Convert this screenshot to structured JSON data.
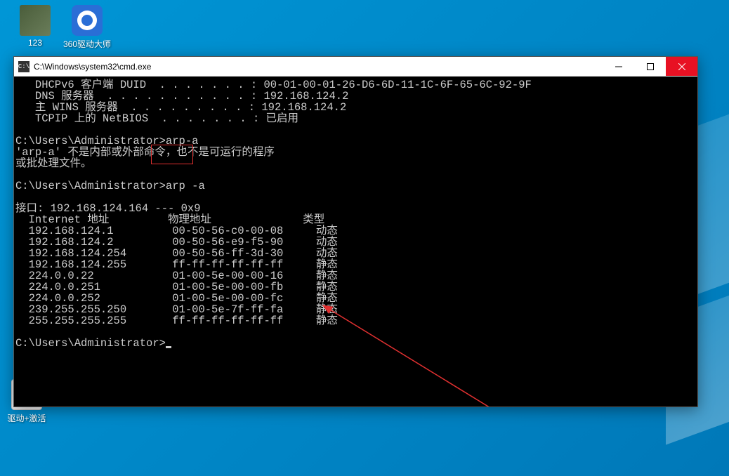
{
  "desktop": {
    "icons": [
      {
        "label": "123"
      },
      {
        "label": "360驱动大师"
      },
      {
        "label": "驱动+激活"
      }
    ]
  },
  "window": {
    "title": "C:\\Windows\\system32\\cmd.exe"
  },
  "terminal": {
    "lines": [
      "   DHCPv6 客户端 DUID  . . . . . . . : 00-01-00-01-26-D6-6D-11-1C-6F-65-6C-92-9F",
      "   DNS 服务器  . . . . . . . . . . . : 192.168.124.2",
      "   主 WINS 服务器  . . . . . . . . . : 192.168.124.2",
      "   TCPIP 上的 NetBIOS  . . . . . . . : 已启用",
      "",
      "C:\\Users\\Administrator>arp-a",
      "'arp-a' 不是内部或外部命令，也不是可运行的程序",
      "或批处理文件。",
      "",
      "C:\\Users\\Administrator>arp -a",
      "",
      "接口: 192.168.124.164 --- 0x9",
      "  Internet 地址         物理地址              类型",
      "  192.168.124.1         00-50-56-c0-00-08     动态",
      "  192.168.124.2         00-50-56-e9-f5-90     动态",
      "  192.168.124.254       00-50-56-ff-3d-30     动态",
      "  192.168.124.255       ff-ff-ff-ff-ff-ff     静态",
      "  224.0.0.22            01-00-5e-00-00-16     静态",
      "  224.0.0.251           01-00-5e-00-00-fb     静态",
      "  224.0.0.252           01-00-5e-00-00-fc     静态",
      "  239.255.255.250       01-00-5e-7f-ff-fa     静态",
      "  255.255.255.255       ff-ff-ff-ff-ff-ff     静态",
      "",
      "C:\\Users\\Administrator>"
    ],
    "arp_table": {
      "interface": "192.168.124.164 --- 0x9",
      "headers": [
        "Internet 地址",
        "物理地址",
        "类型"
      ],
      "rows": [
        {
          "ip": "192.168.124.1",
          "mac": "00-50-56-c0-00-08",
          "type": "动态"
        },
        {
          "ip": "192.168.124.2",
          "mac": "00-50-56-e9-f5-90",
          "type": "动态"
        },
        {
          "ip": "192.168.124.254",
          "mac": "00-50-56-ff-3d-30",
          "type": "动态"
        },
        {
          "ip": "192.168.124.255",
          "mac": "ff-ff-ff-ff-ff-ff",
          "type": "静态"
        },
        {
          "ip": "224.0.0.22",
          "mac": "01-00-5e-00-00-16",
          "type": "静态"
        },
        {
          "ip": "224.0.0.251",
          "mac": "01-00-5e-00-00-fb",
          "type": "静态"
        },
        {
          "ip": "224.0.0.252",
          "mac": "01-00-5e-00-00-fc",
          "type": "静态"
        },
        {
          "ip": "239.255.255.250",
          "mac": "01-00-5e-7f-ff-fa",
          "type": "静态"
        },
        {
          "ip": "255.255.255.255",
          "mac": "ff-ff-ff-ff-ff-ff",
          "type": "静态"
        }
      ]
    },
    "prompt": "C:\\Users\\Administrator>"
  }
}
